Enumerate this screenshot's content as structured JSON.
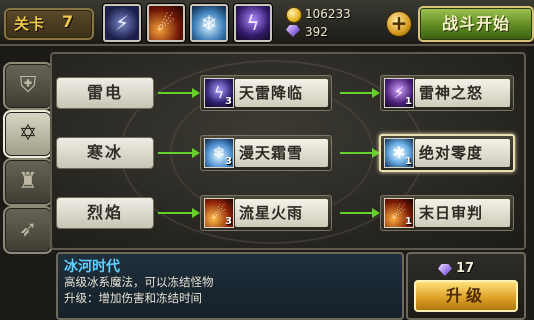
{
  "header": {
    "level_label": "关卡",
    "level_value": "7",
    "equipped_skills": [
      "lightning-skill-icon",
      "meteor-skill-icon",
      "ice-skill-icon",
      "thunder-skill-icon"
    ],
    "gold": "106233",
    "gems": "392",
    "fight_label": "战斗开始"
  },
  "tabs": [
    {
      "name": "helmet-icon",
      "active": false
    },
    {
      "name": "magic-star-icon",
      "active": true
    },
    {
      "name": "castle-icon",
      "active": false
    },
    {
      "name": "bow-icon",
      "active": false
    }
  ],
  "rows": [
    {
      "category": "雷电",
      "skill": {
        "name": "天雷降临",
        "level": "3",
        "icon": "thunder-icon"
      },
      "next": {
        "name": "雷神之怒",
        "level": "1",
        "icon": "storm-icon"
      }
    },
    {
      "category": "寒冰",
      "skill": {
        "name": "漫天霜雪",
        "level": "3",
        "icon": "snow-icon"
      },
      "next": {
        "name": "绝对零度",
        "level": "1",
        "icon": "absolute-zero-icon",
        "selected": true
      }
    },
    {
      "category": "烈焰",
      "skill": {
        "name": "流星火雨",
        "level": "3",
        "icon": "meteor-icon"
      },
      "next": {
        "name": "末日审判",
        "level": "1",
        "icon": "doom-icon"
      }
    }
  ],
  "info": {
    "title": "冰河时代",
    "desc": "高级冰系魔法，可以冻结怪物",
    "upgrade_desc": "升级：增加伤害和冻结时间"
  },
  "upgrade": {
    "cost": "17",
    "button_label": "升级"
  },
  "colors": {
    "accent_green": "#66d02a",
    "info_title": "#5fd0ff",
    "gold_text": "#f2c84a"
  }
}
